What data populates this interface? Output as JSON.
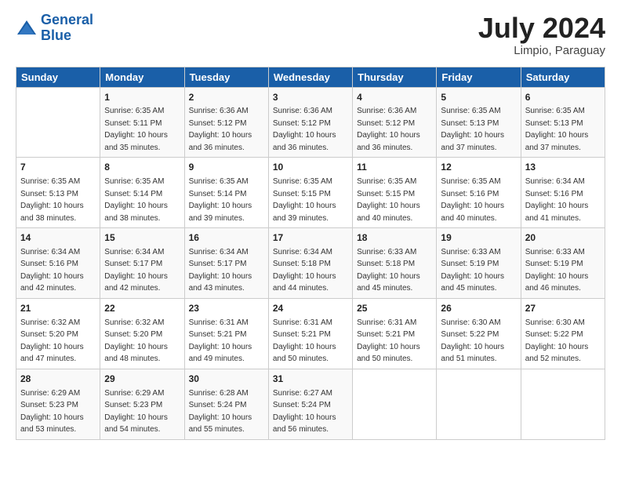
{
  "header": {
    "logo_line1": "General",
    "logo_line2": "Blue",
    "month_year": "July 2024",
    "location": "Limpio, Paraguay"
  },
  "weekdays": [
    "Sunday",
    "Monday",
    "Tuesday",
    "Wednesday",
    "Thursday",
    "Friday",
    "Saturday"
  ],
  "weeks": [
    [
      {
        "day": "",
        "sunrise": "",
        "sunset": "",
        "daylight": ""
      },
      {
        "day": "1",
        "sunrise": "Sunrise: 6:35 AM",
        "sunset": "Sunset: 5:11 PM",
        "daylight": "Daylight: 10 hours and 35 minutes."
      },
      {
        "day": "2",
        "sunrise": "Sunrise: 6:36 AM",
        "sunset": "Sunset: 5:12 PM",
        "daylight": "Daylight: 10 hours and 36 minutes."
      },
      {
        "day": "3",
        "sunrise": "Sunrise: 6:36 AM",
        "sunset": "Sunset: 5:12 PM",
        "daylight": "Daylight: 10 hours and 36 minutes."
      },
      {
        "day": "4",
        "sunrise": "Sunrise: 6:36 AM",
        "sunset": "Sunset: 5:12 PM",
        "daylight": "Daylight: 10 hours and 36 minutes."
      },
      {
        "day": "5",
        "sunrise": "Sunrise: 6:35 AM",
        "sunset": "Sunset: 5:13 PM",
        "daylight": "Daylight: 10 hours and 37 minutes."
      },
      {
        "day": "6",
        "sunrise": "Sunrise: 6:35 AM",
        "sunset": "Sunset: 5:13 PM",
        "daylight": "Daylight: 10 hours and 37 minutes."
      }
    ],
    [
      {
        "day": "7",
        "sunrise": "Sunrise: 6:35 AM",
        "sunset": "Sunset: 5:13 PM",
        "daylight": "Daylight: 10 hours and 38 minutes."
      },
      {
        "day": "8",
        "sunrise": "Sunrise: 6:35 AM",
        "sunset": "Sunset: 5:14 PM",
        "daylight": "Daylight: 10 hours and 38 minutes."
      },
      {
        "day": "9",
        "sunrise": "Sunrise: 6:35 AM",
        "sunset": "Sunset: 5:14 PM",
        "daylight": "Daylight: 10 hours and 39 minutes."
      },
      {
        "day": "10",
        "sunrise": "Sunrise: 6:35 AM",
        "sunset": "Sunset: 5:15 PM",
        "daylight": "Daylight: 10 hours and 39 minutes."
      },
      {
        "day": "11",
        "sunrise": "Sunrise: 6:35 AM",
        "sunset": "Sunset: 5:15 PM",
        "daylight": "Daylight: 10 hours and 40 minutes."
      },
      {
        "day": "12",
        "sunrise": "Sunrise: 6:35 AM",
        "sunset": "Sunset: 5:16 PM",
        "daylight": "Daylight: 10 hours and 40 minutes."
      },
      {
        "day": "13",
        "sunrise": "Sunrise: 6:34 AM",
        "sunset": "Sunset: 5:16 PM",
        "daylight": "Daylight: 10 hours and 41 minutes."
      }
    ],
    [
      {
        "day": "14",
        "sunrise": "Sunrise: 6:34 AM",
        "sunset": "Sunset: 5:16 PM",
        "daylight": "Daylight: 10 hours and 42 minutes."
      },
      {
        "day": "15",
        "sunrise": "Sunrise: 6:34 AM",
        "sunset": "Sunset: 5:17 PM",
        "daylight": "Daylight: 10 hours and 42 minutes."
      },
      {
        "day": "16",
        "sunrise": "Sunrise: 6:34 AM",
        "sunset": "Sunset: 5:17 PM",
        "daylight": "Daylight: 10 hours and 43 minutes."
      },
      {
        "day": "17",
        "sunrise": "Sunrise: 6:34 AM",
        "sunset": "Sunset: 5:18 PM",
        "daylight": "Daylight: 10 hours and 44 minutes."
      },
      {
        "day": "18",
        "sunrise": "Sunrise: 6:33 AM",
        "sunset": "Sunset: 5:18 PM",
        "daylight": "Daylight: 10 hours and 45 minutes."
      },
      {
        "day": "19",
        "sunrise": "Sunrise: 6:33 AM",
        "sunset": "Sunset: 5:19 PM",
        "daylight": "Daylight: 10 hours and 45 minutes."
      },
      {
        "day": "20",
        "sunrise": "Sunrise: 6:33 AM",
        "sunset": "Sunset: 5:19 PM",
        "daylight": "Daylight: 10 hours and 46 minutes."
      }
    ],
    [
      {
        "day": "21",
        "sunrise": "Sunrise: 6:32 AM",
        "sunset": "Sunset: 5:20 PM",
        "daylight": "Daylight: 10 hours and 47 minutes."
      },
      {
        "day": "22",
        "sunrise": "Sunrise: 6:32 AM",
        "sunset": "Sunset: 5:20 PM",
        "daylight": "Daylight: 10 hours and 48 minutes."
      },
      {
        "day": "23",
        "sunrise": "Sunrise: 6:31 AM",
        "sunset": "Sunset: 5:21 PM",
        "daylight": "Daylight: 10 hours and 49 minutes."
      },
      {
        "day": "24",
        "sunrise": "Sunrise: 6:31 AM",
        "sunset": "Sunset: 5:21 PM",
        "daylight": "Daylight: 10 hours and 50 minutes."
      },
      {
        "day": "25",
        "sunrise": "Sunrise: 6:31 AM",
        "sunset": "Sunset: 5:21 PM",
        "daylight": "Daylight: 10 hours and 50 minutes."
      },
      {
        "day": "26",
        "sunrise": "Sunrise: 6:30 AM",
        "sunset": "Sunset: 5:22 PM",
        "daylight": "Daylight: 10 hours and 51 minutes."
      },
      {
        "day": "27",
        "sunrise": "Sunrise: 6:30 AM",
        "sunset": "Sunset: 5:22 PM",
        "daylight": "Daylight: 10 hours and 52 minutes."
      }
    ],
    [
      {
        "day": "28",
        "sunrise": "Sunrise: 6:29 AM",
        "sunset": "Sunset: 5:23 PM",
        "daylight": "Daylight: 10 hours and 53 minutes."
      },
      {
        "day": "29",
        "sunrise": "Sunrise: 6:29 AM",
        "sunset": "Sunset: 5:23 PM",
        "daylight": "Daylight: 10 hours and 54 minutes."
      },
      {
        "day": "30",
        "sunrise": "Sunrise: 6:28 AM",
        "sunset": "Sunset: 5:24 PM",
        "daylight": "Daylight: 10 hours and 55 minutes."
      },
      {
        "day": "31",
        "sunrise": "Sunrise: 6:27 AM",
        "sunset": "Sunset: 5:24 PM",
        "daylight": "Daylight: 10 hours and 56 minutes."
      },
      {
        "day": "",
        "sunrise": "",
        "sunset": "",
        "daylight": ""
      },
      {
        "day": "",
        "sunrise": "",
        "sunset": "",
        "daylight": ""
      },
      {
        "day": "",
        "sunrise": "",
        "sunset": "",
        "daylight": ""
      }
    ]
  ]
}
